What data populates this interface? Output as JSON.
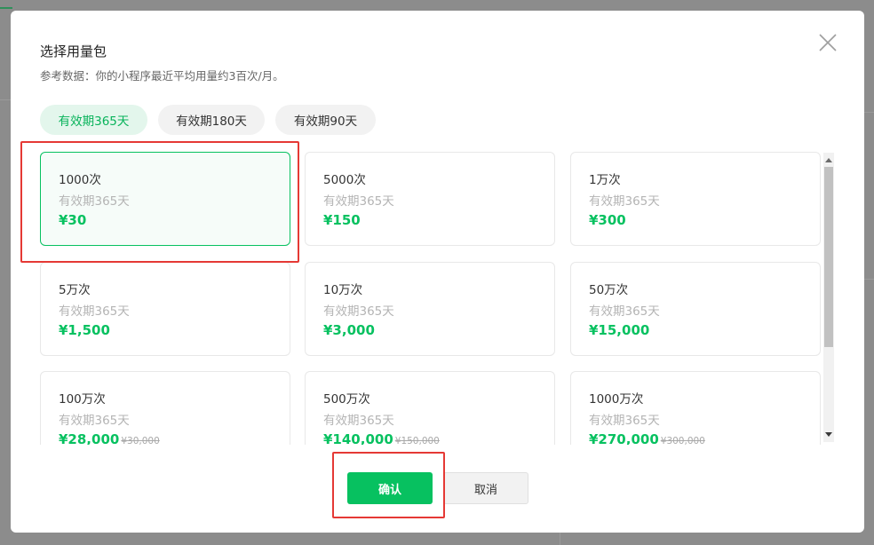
{
  "dialog": {
    "title": "选择用量包",
    "subtitle": "参考数据：你的小程序最近平均用量约3百次/月。"
  },
  "tabs": [
    {
      "label": "有效期365天",
      "active": true
    },
    {
      "label": "有效期180天",
      "active": false
    },
    {
      "label": "有效期90天",
      "active": false
    }
  ],
  "packages": [
    {
      "name": "1000次",
      "validity": "有效期365天",
      "price": "¥30",
      "original_price": "",
      "selected": true
    },
    {
      "name": "5000次",
      "validity": "有效期365天",
      "price": "¥150",
      "original_price": "",
      "selected": false
    },
    {
      "name": "1万次",
      "validity": "有效期365天",
      "price": "¥300",
      "original_price": "",
      "selected": false
    },
    {
      "name": "5万次",
      "validity": "有效期365天",
      "price": "¥1,500",
      "original_price": "",
      "selected": false
    },
    {
      "name": "10万次",
      "validity": "有效期365天",
      "price": "¥3,000",
      "original_price": "",
      "selected": false
    },
    {
      "name": "50万次",
      "validity": "有效期365天",
      "price": "¥15,000",
      "original_price": "",
      "selected": false
    },
    {
      "name": "100万次",
      "validity": "有效期365天",
      "price": "¥28,000",
      "original_price": "¥30,000",
      "selected": false
    },
    {
      "name": "500万次",
      "validity": "有效期365天",
      "price": "¥140,000",
      "original_price": "¥150,000",
      "selected": false
    },
    {
      "name": "1000万次",
      "validity": "有效期365天",
      "price": "¥270,000",
      "original_price": "¥300,000",
      "selected": false
    }
  ],
  "footer": {
    "confirm_label": "确认",
    "cancel_label": "取消"
  },
  "colors": {
    "accent": "#07c160",
    "highlight": "#e53935"
  },
  "icons": {
    "close": "close-icon",
    "scroll_up": "scroll-up-arrow-icon",
    "scroll_down": "scroll-down-arrow-icon"
  }
}
